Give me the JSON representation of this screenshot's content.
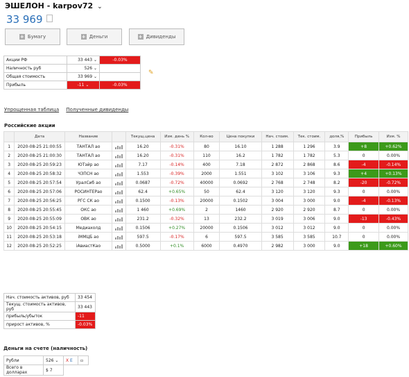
{
  "header": {
    "title": "ЭШЕЛОН - karpov72",
    "chevron": "⌄",
    "value": "33 969"
  },
  "buttons": [
    {
      "label": "Бумагу"
    },
    {
      "label": "Деньги"
    },
    {
      "label": "Дивиденды"
    }
  ],
  "summary": [
    {
      "label": "Акции РФ",
      "value": "33 443",
      "extra": "-0.03%",
      "extra_style": "red"
    },
    {
      "label": "Наличность руб",
      "value": "526",
      "extra": "",
      "extra_style": ""
    },
    {
      "label": "Общая стоимость",
      "value": "33 969",
      "extra": "",
      "extra_style": ""
    },
    {
      "label": "Прибыль",
      "value": "-11",
      "extra": "-0.03%",
      "extra_style": "red",
      "value_style": "red"
    }
  ],
  "links": [
    "Упрощенная таблица",
    "Полученные дивиденды"
  ],
  "section_title": "Российские акции",
  "table": {
    "headers": [
      "",
      "Дата",
      "Название",
      "",
      "Текущ.цена",
      "Изм. день %",
      "Кол-во",
      "Цена покупки",
      "Нач. стоим.",
      "Тек. стоим.",
      "доля,%",
      "Прибыль",
      "Изм. %"
    ],
    "rows": [
      [
        "1",
        "2020-08-25 21:00:55",
        "ТАНТАЛ ао",
        "16.20",
        "-0.31%",
        "80",
        "16.10",
        "1 288",
        "1 296",
        "3.9",
        "+8",
        "+0.62%",
        "g",
        "g"
      ],
      [
        "2",
        "2020-08-25 21:00:30",
        "ТАНТАЛ ао",
        "16.20",
        "-0.31%",
        "110",
        "16.2",
        "1 782",
        "1 782",
        "5.3",
        "0",
        "0.00%",
        "",
        ""
      ],
      [
        "3",
        "2020-08-25 20:59:23",
        "ЮТэйр ао",
        "7.17",
        "-0.14%",
        "400",
        "7.18",
        "2 872",
        "2 868",
        "8.6",
        "-4",
        "-0.14%",
        "r",
        "r"
      ],
      [
        "4",
        "2020-08-25 20:58:32",
        "ЧЗПСН ао",
        "1.553",
        "-0.39%",
        "2000",
        "1.551",
        "3 102",
        "3 106",
        "9.3",
        "+4",
        "+0.13%",
        "g",
        "g"
      ],
      [
        "5",
        "2020-08-25 20:57:54",
        "УралСиб ао",
        "0.0687",
        "-0.72%",
        "40000",
        "0.0692",
        "2 768",
        "2 748",
        "8.2",
        "-20",
        "-0.72%",
        "r",
        "r"
      ],
      [
        "6",
        "2020-08-25 20:57:06",
        "РОСИНТЕРао",
        "62.4",
        "+0.65%",
        "50",
        "62.4",
        "3 120",
        "3 120",
        "9.3",
        "0",
        "0.00%",
        "",
        ""
      ],
      [
        "7",
        "2020-08-25 20:56:25",
        "РГС СК ао",
        "0.1500",
        "-0.13%",
        "20000",
        "0.1502",
        "3 004",
        "3 000",
        "9.0",
        "-4",
        "-0.13%",
        "r",
        "r"
      ],
      [
        "8",
        "2020-08-25 20:55:45",
        "ОКС ао",
        "1 460",
        "+0.69%",
        "2",
        "1460",
        "2 920",
        "2 920",
        "8.7",
        "0",
        "0.00%",
        "",
        ""
      ],
      [
        "9",
        "2020-08-25 20:55:09",
        "ОВК ао",
        "231.2",
        "-0.32%",
        "13",
        "232.2",
        "3 019",
        "3 006",
        "9.0",
        "-13",
        "-0.43%",
        "r",
        "r"
      ],
      [
        "10",
        "2020-08-25 20:54:15",
        "Медиахолд",
        "0.1506",
        "+0.27%",
        "20000",
        "0.1506",
        "3 012",
        "3 012",
        "9.0",
        "0",
        "0.00%",
        "",
        ""
      ],
      [
        "11",
        "2020-08-25 20:53:18",
        "iММЦБ ао",
        "597.5",
        "-0.17%",
        "6",
        "597.5",
        "3 585",
        "3 585",
        "10.7",
        "0",
        "0.00%",
        "",
        ""
      ],
      [
        "12",
        "2020-08-25 20:52:25",
        "iАвиастКао",
        "0.5000",
        "+0.1%",
        "6000",
        "0.4970",
        "2 982",
        "3 000",
        "9.0",
        "+18",
        "+0.60%",
        "g",
        "g"
      ]
    ]
  },
  "summary2": [
    {
      "label": "Нач. стоимость активов, руб",
      "value": "33 454",
      "style": ""
    },
    {
      "label": "Текущ. стоимость активов, руб",
      "value": "33 443",
      "style": ""
    },
    {
      "label": "прибыль/убыток",
      "value": "-11",
      "style": "red"
    },
    {
      "label": "прирост активов, %",
      "value": "-0.03%",
      "style": "red"
    }
  ],
  "cash": {
    "title": "Деньги на счете (наличность)",
    "rows": [
      {
        "label": "Рубли",
        "value": "526",
        "x": "X",
        "e": "E"
      },
      {
        "label": "Всего в долларах",
        "value": "$ 7"
      }
    ]
  },
  "colors": {
    "red": "#e31b1b",
    "green": "#3c9a1a",
    "accent": "#2a6fb8"
  }
}
